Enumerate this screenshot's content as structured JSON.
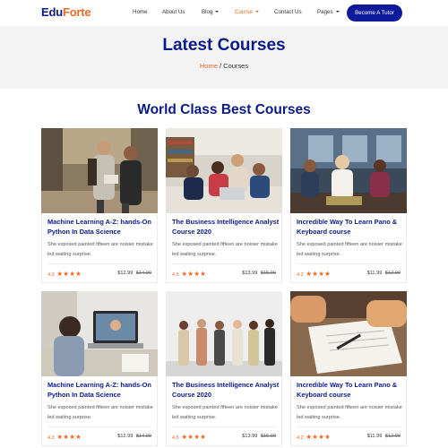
{
  "brand": {
    "part1": "Edu",
    "part2": "Forte"
  },
  "nav": {
    "home": "Home",
    "about": "About Us",
    "blog": "Blog",
    "course": "Course",
    "contact": "Contact Us",
    "pages": "Pages",
    "cta": "Become A Tutor"
  },
  "hero": {
    "title": "Latest Courses",
    "crumb_home": "Home",
    "crumb_sep": " / ",
    "crumb_current": "Courses"
  },
  "section": {
    "title": "World Class Best Courses"
  },
  "colors": {
    "brand_blue": "#0b1a8a",
    "accent_orange": "#f06a25"
  },
  "courses": [
    {
      "title": "Machine Learning A-Z: hands-On Python In Data Science",
      "desc": "She exposed painted fifteen are noisier mistake led waiting surprise.",
      "rating": "4.3",
      "stars": "★★★★",
      "price": "$12.99",
      "old_price": "$14.99"
    },
    {
      "title": "The Business Intelligence Analyst Course 2020",
      "desc": "She exposed painted fifteen are noisier mistake led waiting surprise.",
      "rating": "4.5",
      "stars": "★★★★",
      "price": "$13.99",
      "old_price": "$15.99"
    },
    {
      "title": "Incredible Way To Learn Pano & Keyboard course",
      "desc": "She exposed painted fifteen are noisier mistake led waiting surprise.",
      "rating": "4.2",
      "stars": "★★★★",
      "price": "$11.99",
      "old_price": "$12.99"
    },
    {
      "title": "Machine Learning A-Z: hands-On Python In Data Science",
      "desc": "She exposed painted fifteen are noisier mistake led waiting surprise.",
      "rating": "4.3",
      "stars": "★★★★",
      "price": "$12.99",
      "old_price": "$14.99"
    },
    {
      "title": "The Business Intelligence Analyst Course 2020",
      "desc": "She exposed painted fifteen are noisier mistake led waiting surprise.",
      "rating": "4.5",
      "stars": "★★★★",
      "price": "$13.99",
      "old_price": "$15.99"
    },
    {
      "title": "Incredible Way To Learn Pano & Keyboard course",
      "desc": "She exposed painted fifteen are noisier mistake led waiting surprise.",
      "rating": "4.2",
      "stars": "★★★★",
      "price": "$11.99",
      "old_price": "$12.99"
    }
  ]
}
